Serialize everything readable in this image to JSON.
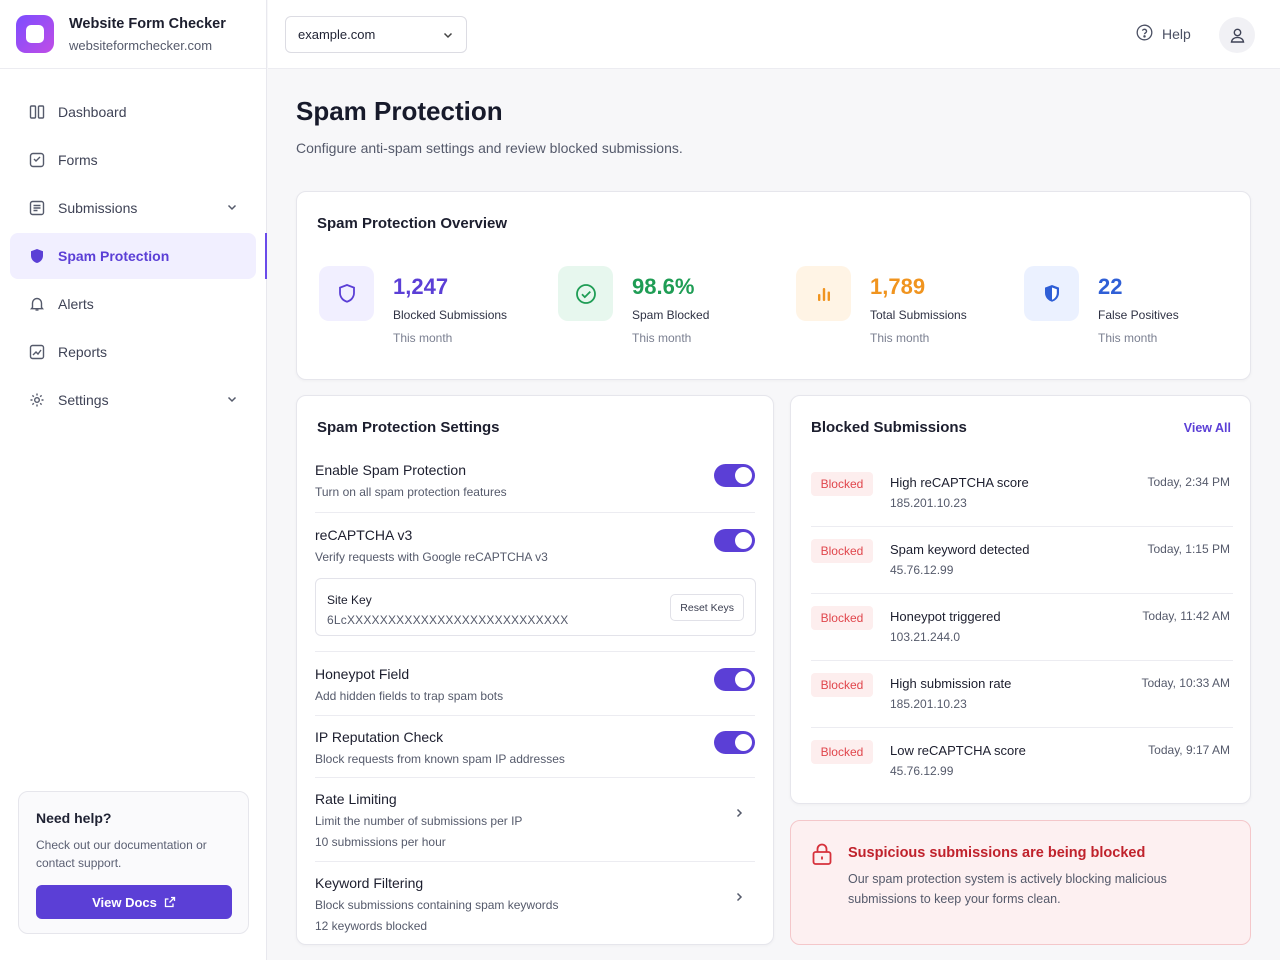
{
  "brand": {
    "name": "Website Form Checker",
    "url": "websiteformchecker.com"
  },
  "sidebar": {
    "items": [
      {
        "label": "Dashboard",
        "icon": "columns-icon"
      },
      {
        "label": "Forms",
        "icon": "form-icon"
      },
      {
        "label": "Submissions",
        "icon": "list-icon"
      },
      {
        "label": "Spam Protection",
        "icon": "shield-icon"
      },
      {
        "label": "Alerts",
        "icon": "bell-icon"
      },
      {
        "label": "Reports",
        "icon": "chart-icon"
      },
      {
        "label": "Settings",
        "icon": "gear-icon"
      }
    ],
    "active": "Spam Protection",
    "help": {
      "title": "Need help?",
      "text": "Check out our documentation or contact support.",
      "button": "View Docs"
    }
  },
  "topbar": {
    "site": "example.com",
    "help": "Help"
  },
  "page": {
    "title": "Spam Protection",
    "subtitle": "Configure anti-spam settings and review blocked submissions."
  },
  "overview": {
    "title": "Spam Protection Overview",
    "stats": [
      {
        "value": "1,247",
        "label": "Blocked Submissions",
        "sub": "This month",
        "color": "#5b3fd6",
        "bg": "#f1efff"
      },
      {
        "value": "98.6%",
        "label": "Spam Blocked",
        "sub": "This month",
        "color": "#1f9d55",
        "bg": "#e7f7ee"
      },
      {
        "value": "1,789",
        "label": "Total Submissions",
        "sub": "This month",
        "color": "#f0941f",
        "bg": "#fff4e5"
      },
      {
        "value": "22",
        "label": "False Positives",
        "sub": "This month",
        "color": "#2f5fd6",
        "bg": "#ebf1ff"
      }
    ]
  },
  "settings": {
    "title": "Spam Protection Settings",
    "rows": [
      {
        "title": "Enable Spam Protection",
        "desc": "Turn on all spam protection features",
        "enabled": true
      },
      {
        "title": "reCAPTCHA v3",
        "desc": "Verify requests with Google reCAPTCHA v3",
        "enabled": true
      },
      {
        "title": "Honeypot Field",
        "desc": "Add hidden fields to trap spam bots",
        "enabled": true
      },
      {
        "title": "IP Reputation Check",
        "desc": "Block requests from known spam IP addresses",
        "enabled": true
      },
      {
        "title": "Rate Limiting",
        "desc": "Limit the number of submissions per IP",
        "extra": "10 submissions per hour"
      },
      {
        "title": "Keyword Filtering",
        "desc": "Block submissions containing spam keywords",
        "extra": "12 keywords blocked"
      }
    ],
    "site_key": {
      "label": "Site Key",
      "value": "6LcXXXXXXXXXXXXXXXXXXXXXXXXXXX",
      "button": "Reset Keys"
    }
  },
  "blocked": {
    "title": "Blocked Submissions",
    "view_all": "View All",
    "items": [
      {
        "status": "Blocked",
        "reason": "High reCAPTCHA score",
        "ip": "185.201.10.23",
        "time": "Today, 2:34 PM"
      },
      {
        "status": "Blocked",
        "reason": "Spam keyword detected",
        "ip": "45.76.12.99",
        "time": "Today, 1:15 PM"
      },
      {
        "status": "Blocked",
        "reason": "Honeypot triggered",
        "ip": "103.21.244.0",
        "time": "Today, 11:42 AM"
      },
      {
        "status": "Blocked",
        "reason": "High submission rate",
        "ip": "185.201.10.23",
        "time": "Today, 10:33 AM"
      },
      {
        "status": "Blocked",
        "reason": "Low reCAPTCHA score",
        "ip": "45.76.12.99",
        "time": "Today, 9:17 AM"
      }
    ]
  },
  "alert": {
    "title": "Suspicious submissions are being blocked",
    "text": "Our spam protection system is actively blocking malicious submissions to keep your forms clean."
  },
  "colors": {
    "accent": "#5b3fd6",
    "danger": "#e0464c"
  }
}
